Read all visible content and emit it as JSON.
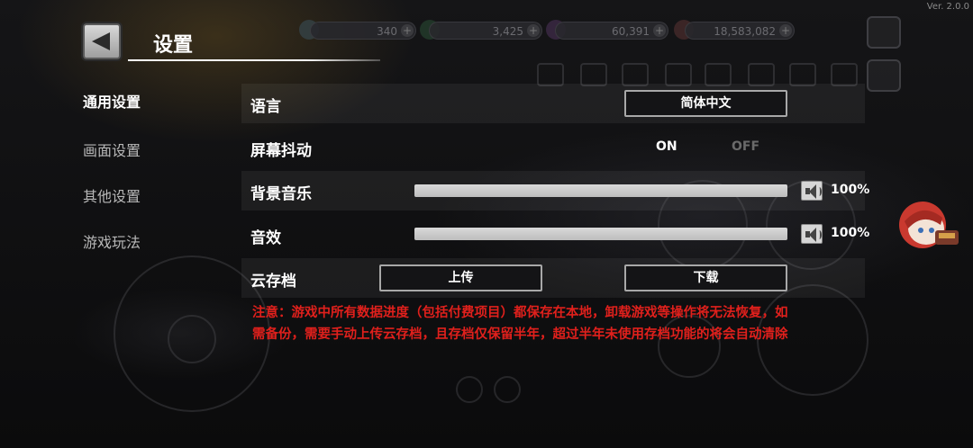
{
  "app": {
    "version": "Ver. 2.0.0"
  },
  "header": {
    "title": "设置"
  },
  "hud": {
    "values": [
      "340",
      "3,425",
      "60,391",
      "18,583,082"
    ]
  },
  "nav": {
    "items": [
      {
        "label": "通用设置",
        "active": true
      },
      {
        "label": "画面设置",
        "active": false
      },
      {
        "label": "其他设置",
        "active": false
      },
      {
        "label": "游戏玩法",
        "active": false
      }
    ]
  },
  "settings": {
    "language": {
      "label": "语言",
      "value": "简体中文"
    },
    "shake": {
      "label": "屏幕抖动",
      "on_label": "ON",
      "off_label": "OFF",
      "selected": "ON"
    },
    "music": {
      "label": "背景音乐",
      "value_text": "100%",
      "level": 1.0
    },
    "sfx": {
      "label": "音效",
      "value_text": "100%",
      "level": 1.0
    },
    "cloud": {
      "label": "云存档",
      "upload_label": "上传",
      "download_label": "下载"
    }
  },
  "notice": {
    "line1": "注意：游戏中所有数据进度（包括付费项目）都保存在本地，卸载游戏等操作将无法恢复，如",
    "line2": "需备份，需要手动上传云存档，且存档仅保留半年，超过半年未使用存档功能的将会自动清除"
  },
  "colors": {
    "notice": "#e0201c",
    "off": "#6a6a6a",
    "accent": "#ffffff"
  },
  "icons": [
    "back-arrow-icon",
    "speaker-icon",
    "mascot-icon"
  ]
}
